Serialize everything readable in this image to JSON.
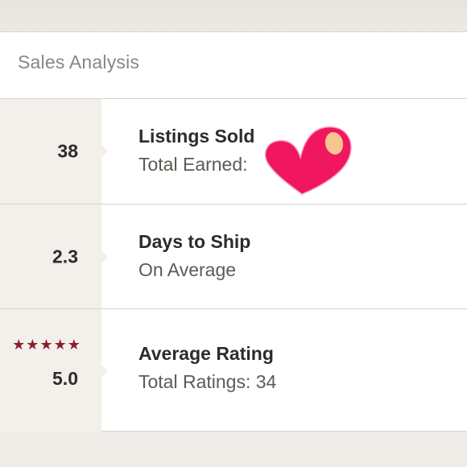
{
  "card": {
    "title": "Sales Analysis"
  },
  "rows": [
    {
      "value": "38",
      "title": "Listings Sold",
      "subtitle": "Total Earned:"
    },
    {
      "value": "2.3",
      "title": "Days to Ship",
      "subtitle": "On Average"
    },
    {
      "value": "5.0",
      "stars": "★★★★★",
      "rating": 5.0,
      "title": "Average Rating",
      "subtitle": "Total Ratings: 34"
    }
  ],
  "colors": {
    "background": "#eeebe6",
    "card": "#ffffff",
    "metric_panel": "#f3f0eb",
    "title": "#8a8580",
    "text_primary": "#2e2b28",
    "text_secondary": "#5f5a55",
    "stars": "#8c1f2c",
    "heart": "#f0165f",
    "heart_highlight": "#f7c58e"
  },
  "icons": {
    "rating": "star-icon",
    "sticker": "heart-icon"
  }
}
